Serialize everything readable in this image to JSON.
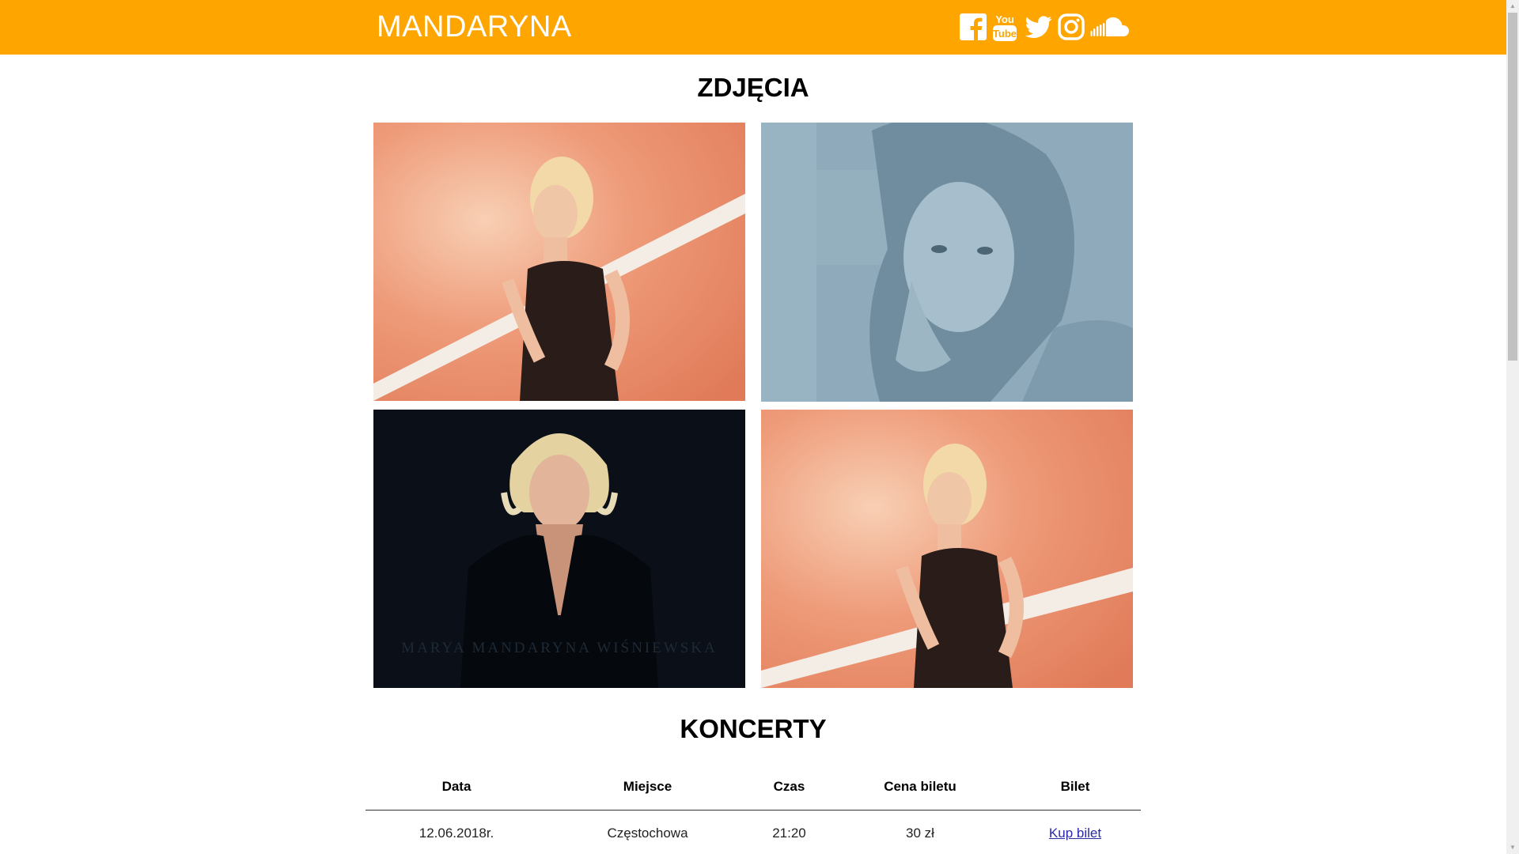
{
  "header": {
    "brand": "MANDARYNA",
    "background_color": "#ffa500",
    "social_icons": [
      "facebook-icon",
      "youtube-icon",
      "twitter-icon",
      "instagram-icon",
      "soundcloud-icon"
    ],
    "youtube_text_top": "You",
    "youtube_text_bottom": "Tube"
  },
  "photos": {
    "title": "ZDJĘCIA",
    "items": [
      {
        "name": "photo-1",
        "tone": "#e8906f"
      },
      {
        "name": "photo-2",
        "tone": "#8aa8b8"
      },
      {
        "name": "photo-3",
        "tone": "#0a0f18",
        "caption": "MARYA MANDARYNA WIŚNIEWSKA"
      },
      {
        "name": "photo-4",
        "tone": "#e8906f"
      }
    ]
  },
  "concerts": {
    "title": "KONCERTY",
    "columns": [
      "Data",
      "Miejsce",
      "Czas",
      "Cena biletu",
      "Bilet"
    ],
    "rows": [
      {
        "date": "12.06.2018r.",
        "place": "Częstochowa",
        "time": "21:20",
        "price": "30 zł",
        "ticket_link": "Kup bilet"
      }
    ],
    "link_color": "#2a2aa8"
  }
}
